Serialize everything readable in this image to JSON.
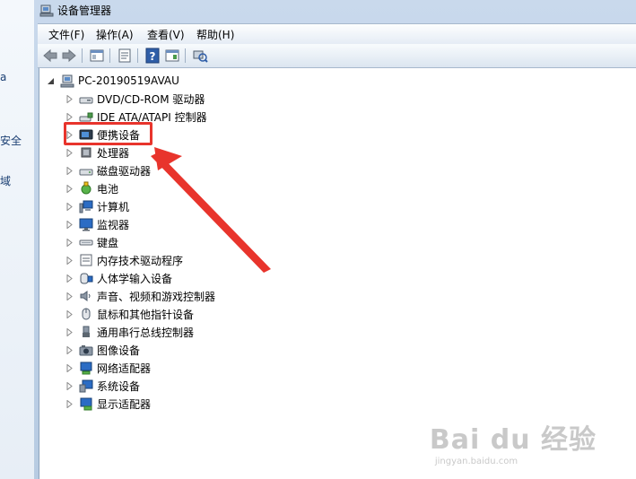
{
  "left_fragments": [
    "安全",
    "域"
  ],
  "window": {
    "title": "设备管理器"
  },
  "menu": [
    "文件(F)",
    "操作(A)",
    "查看(V)",
    "帮助(H)"
  ],
  "tree": {
    "root": "PC-20190519AVAU",
    "items": [
      {
        "label": "DVD/CD-ROM 驱动器",
        "icon": "dvd-drive-icon"
      },
      {
        "label": "IDE ATA/ATAPI 控制器",
        "icon": "ide-controller-icon"
      },
      {
        "label": "便携设备",
        "icon": "portable-device-icon",
        "selected": true
      },
      {
        "label": "处理器",
        "icon": "processor-icon"
      },
      {
        "label": "磁盘驱动器",
        "icon": "disk-drive-icon"
      },
      {
        "label": "电池",
        "icon": "battery-icon"
      },
      {
        "label": "计算机",
        "icon": "computer-icon"
      },
      {
        "label": "监视器",
        "icon": "monitor-icon"
      },
      {
        "label": "键盘",
        "icon": "keyboard-icon"
      },
      {
        "label": "内存技术驱动程序",
        "icon": "memory-driver-icon"
      },
      {
        "label": "人体学输入设备",
        "icon": "hid-icon"
      },
      {
        "label": "声音、视频和游戏控制器",
        "icon": "sound-icon"
      },
      {
        "label": "鼠标和其他指针设备",
        "icon": "mouse-icon"
      },
      {
        "label": "通用串行总线控制器",
        "icon": "usb-icon"
      },
      {
        "label": "图像设备",
        "icon": "camera-icon"
      },
      {
        "label": "网络适配器",
        "icon": "network-adapter-icon"
      },
      {
        "label": "系统设备",
        "icon": "system-device-icon"
      },
      {
        "label": "显示适配器",
        "icon": "display-adapter-icon"
      }
    ]
  },
  "annotation": {
    "highlight_color": "#e8342c"
  },
  "watermark": {
    "logo": "Bai du 经验",
    "url": "jingyan.baidu.com"
  }
}
